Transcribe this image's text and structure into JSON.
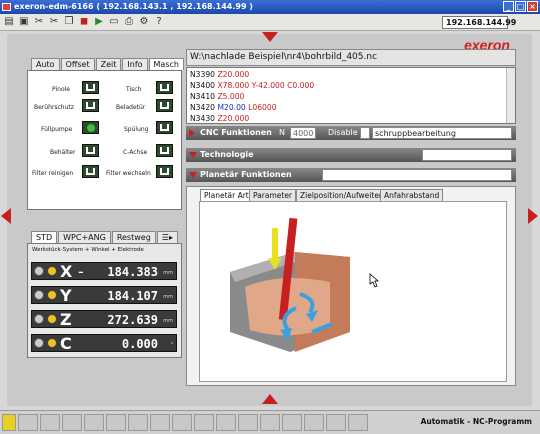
{
  "window": {
    "title": "exeron-edm-6166 ( 192.168.143.1 , 192.168.144.99 )",
    "min": "_",
    "max": "□",
    "close": "×"
  },
  "toolbar": {
    "ip": "192.168.144.99",
    "icons": [
      "doc-icon",
      "folder-icon",
      "tools-icon",
      "scissors-icon",
      "copy-icon",
      "stop-icon",
      "play-icon",
      "monitor-icon",
      "printer-icon",
      "settings-icon",
      "help-icon"
    ],
    "icon_glyphs": [
      "▤",
      "▣",
      "✂",
      "✂",
      "❐",
      "◼",
      "▶",
      "▭",
      "⎙",
      "⚙",
      "?"
    ]
  },
  "brand": {
    "logo": "exeron"
  },
  "machine_tabs": [
    "Auto",
    "Offset",
    "Zeit",
    "Info",
    "Masch"
  ],
  "machine": {
    "left": [
      "Pinole",
      "Berührschutz",
      "Füllpumpe",
      "Behälter",
      "Filter reinigen"
    ],
    "right": [
      "Tisch",
      "Beladetür",
      "Spülung",
      "C-Achse",
      "Filter wechseln"
    ]
  },
  "pos_tabs": [
    "STD",
    "WPC+ANG",
    "Restweg"
  ],
  "pos_caption": "Werkstück-System + Winkel + Elektrode",
  "axes": [
    {
      "name": "X",
      "value": "184.383",
      "unit": "mm"
    },
    {
      "name": "Y",
      "value": "184.107",
      "unit": "mm"
    },
    {
      "name": "Z",
      "value": "272.639",
      "unit": "mm"
    },
    {
      "name": "C",
      "value": "0.000",
      "unit": "°"
    }
  ],
  "program": {
    "path": "W:\\nachlade Beispiel\\nr4\\bohrbild_405.nc"
  },
  "code_lines": [
    {
      "n": "N3390",
      "a": "Z20.000",
      "b": "",
      "c": ""
    },
    {
      "n": "N3400",
      "a": "X78.000",
      "b": "Y-42.000",
      "c": "C0.000"
    },
    {
      "n": "N3410",
      "a": "Z5.000",
      "b": "",
      "c": ""
    },
    {
      "n": "N3420",
      "a": "M20.00",
      "b": "L06000",
      "c": ""
    },
    {
      "n": "N3430",
      "a": "Z20.000",
      "b": "",
      "c": ""
    }
  ],
  "cnc": {
    "label": "CNC Funktionen",
    "n_label": "N",
    "n_value": "4000",
    "disable_label": "Disable",
    "disable_field": "schruppbearbeitung"
  },
  "technologie": {
    "label": "Technologie"
  },
  "planetary": {
    "label": "Planetär Funktionen",
    "tabs": [
      "Planetär Art",
      "Parameter",
      "Zielposition/Aufweiten",
      "Anfahrabstand"
    ]
  },
  "status": {
    "mode": "Automatik - NC-Programm"
  },
  "colors": {
    "accent_red": "#c82020",
    "titlebar_blue": "#1c48a8"
  }
}
